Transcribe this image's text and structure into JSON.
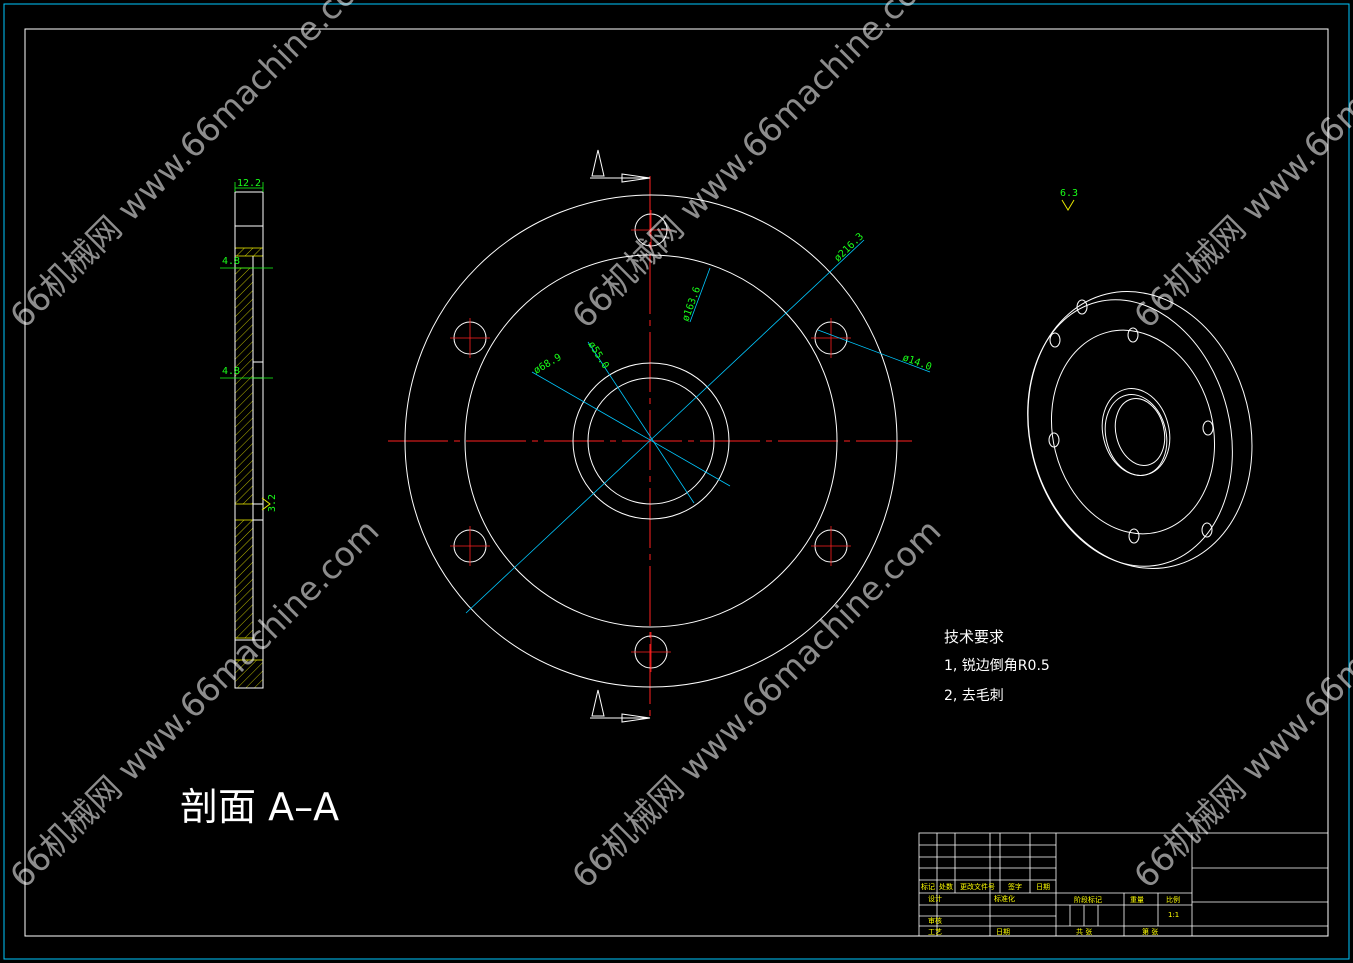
{
  "section_title": "剖面 A–A",
  "section_marker": "A",
  "dimensions": {
    "side_width": "12.2",
    "side_step_top": "4.8",
    "side_step_mid": "4.8",
    "side_thread": "3.2",
    "outer_dia": "ø216.3",
    "pitch_dia": "ø163.6",
    "hole_dia": "ø14.0",
    "bore_outer_dia": "ø68.9",
    "bore_inner_dia": "ø55.0",
    "roughness": "6.3"
  },
  "tech_notes": {
    "title": "技术要求",
    "line1": "1, 锐边倒角R0.5",
    "line2": "2, 去毛刺"
  },
  "title_block": {
    "r1": [
      "标记",
      "处数",
      "更改文件号",
      "签字",
      "日期"
    ],
    "design": "设计",
    "standard": "标准化",
    "check": "审核",
    "process": "工艺",
    "approve": "日期",
    "stage_mark": "阶段标记",
    "weight": "重量",
    "scale": "比例",
    "scale_val": "1:1",
    "sheet_total": "共   张",
    "sheet_no": "第   张"
  },
  "watermark": "66机械网 www.66machine.com",
  "colors": {
    "background": "#000000",
    "outline": "#ffffff",
    "centerline": "#ff2020",
    "dimension": "#19ff19",
    "leader": "#00c8ff",
    "hatch": "#e6e600",
    "frame": "#ffffff"
  }
}
